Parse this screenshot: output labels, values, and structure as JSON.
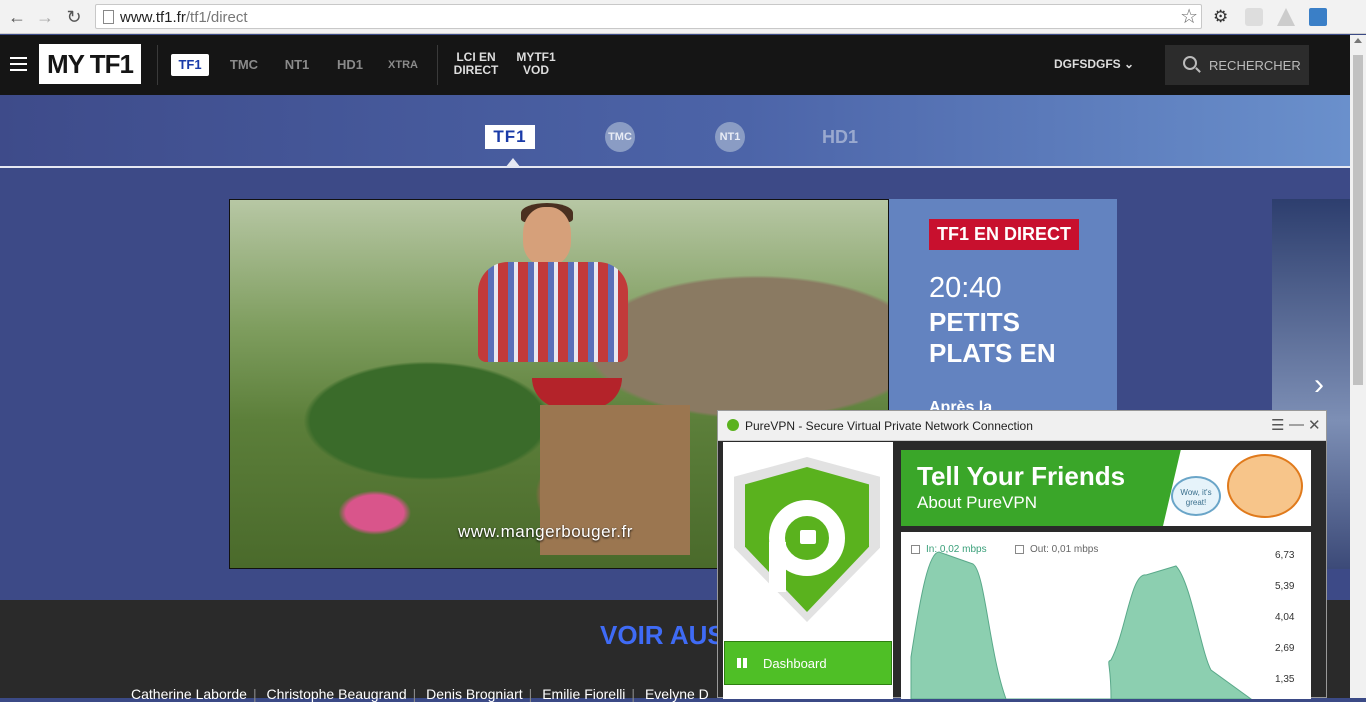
{
  "browser": {
    "url_domain": "www.tf1.fr",
    "url_path": "/tf1/direct"
  },
  "header": {
    "logo": "MY TF1",
    "channels": [
      "TF1",
      "TMC",
      "NT1",
      "HD1",
      "XTRA"
    ],
    "link_lci": "LCI EN DIRECT",
    "link_mytf1": "MYTF1 VOD",
    "user": "DGFSDGFS",
    "search_label": "RECHERCHER"
  },
  "channel_bar": {
    "items": [
      "TF1",
      "TMC",
      "NT1",
      "HD1"
    ],
    "active": "TF1"
  },
  "hero": {
    "video_watermark": "www.mangerbouger.fr",
    "live_badge": "TF1 EN DIRECT",
    "time": "20:40",
    "title": "PETITS PLATS EN",
    "after": "Après la"
  },
  "bottom": {
    "heading": "VOIR AUS",
    "people": [
      "Catherine Laborde",
      "Christophe Beaugrand",
      "Denis Brogniart",
      "Emilie Fiorelli",
      "Evelyne D"
    ]
  },
  "vpn": {
    "title": "PureVPN - Secure Virtual Private Network Connection",
    "dashboard": "Dashboard",
    "banner_line1": "Tell Your Friends",
    "banner_line2": "About PureVPN",
    "bubble_text": "Wow, it's great!",
    "legend_in": "In: 0,02 mbps",
    "legend_out": "Out: 0,01 mbps",
    "y_ticks": [
      "6,73",
      "5,39",
      "4,04",
      "2,69",
      "1,35"
    ]
  },
  "colors": {
    "live_red": "#c8102e",
    "vpn_green": "#5ab21e",
    "voir_blue": "#3f6bf5"
  }
}
